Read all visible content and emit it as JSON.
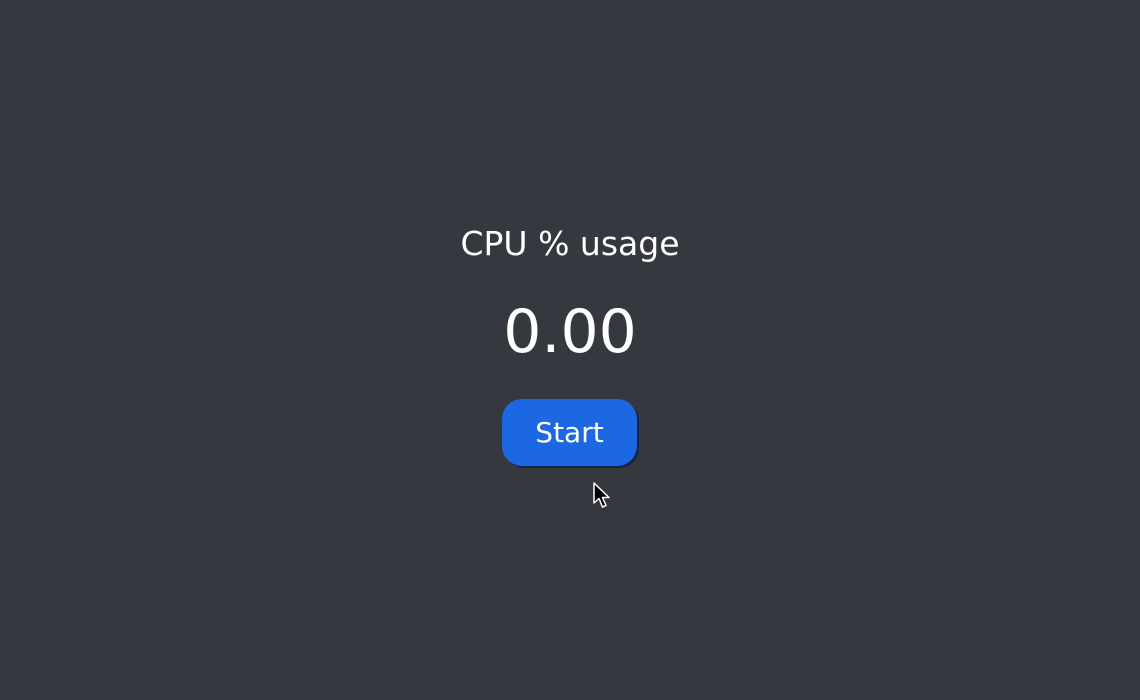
{
  "colors": {
    "background": "#363840",
    "accent": "#1c68e2",
    "text": "#ffffff"
  },
  "metric": {
    "label": "CPU % usage",
    "value": "0.00"
  },
  "controls": {
    "start_label": "Start"
  },
  "cursor": {
    "icon": "mouse-pointer-icon"
  }
}
